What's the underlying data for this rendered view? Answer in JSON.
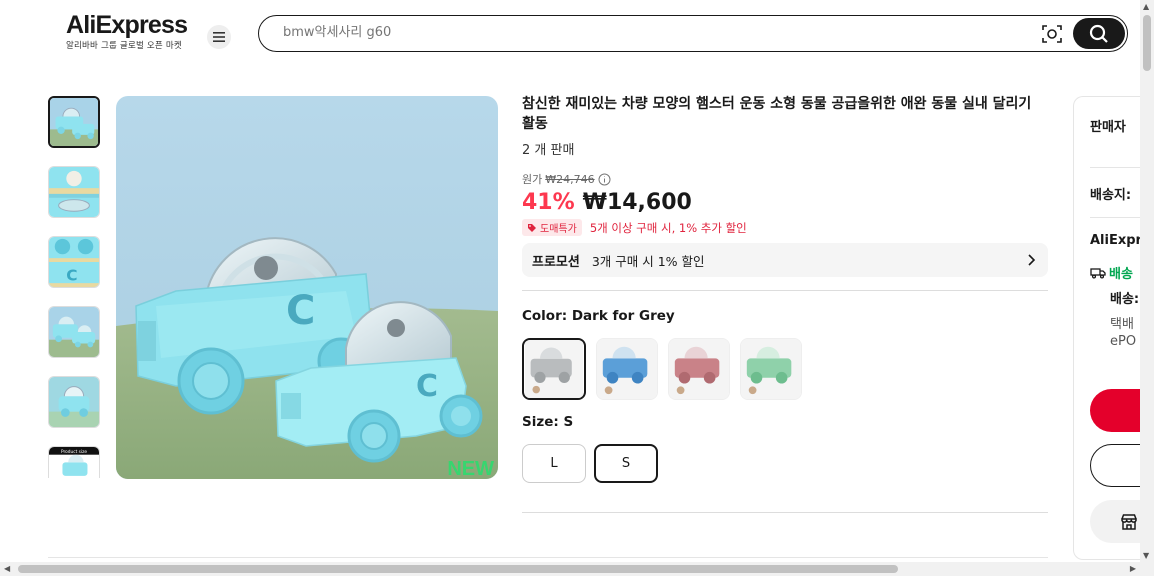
{
  "header": {
    "logo_text": "AliExpress",
    "logo_sub": "알리바바 그룹 글로벌 오픈 마켓",
    "search_placeholder": "bmw악세사리 g60"
  },
  "gallery": {
    "thumb_count": 6,
    "badge": "NEW",
    "thumb6_label": "Product size"
  },
  "product": {
    "title": "참신한 재미있는 차량 모양의 햄스터 운동 소형 동물 공급을위한 애완 동물 실내 달리기 활동",
    "sold": "2 개 판매",
    "original_label": "원가",
    "original_price": "₩24,746",
    "discount": "41%",
    "price": "₩14,600",
    "wholesale_badge": "도매특가",
    "wholesale_text": "5개 이상 구매 시, 1% 추가 할인",
    "promo_title": "프로모션",
    "promo_text": "3개 구매 시 1% 할인",
    "color_label": "Color: Dark for Grey",
    "swatches": [
      {
        "name": "grey",
        "color": "#b9bcbe"
      },
      {
        "name": "blue",
        "color": "#5b9fd8"
      },
      {
        "name": "red",
        "color": "#c98288"
      },
      {
        "name": "green",
        "color": "#8fd1aa"
      }
    ],
    "size_label": "Size: S",
    "sizes": [
      "L",
      "S"
    ],
    "selected_size": "S"
  },
  "side_panel": {
    "seller_label": "판매자",
    "ship_to_label": "배송지:",
    "ae_label": "AliExpre",
    "green_label": "배송",
    "delivery_label": "배송:",
    "line1": "택배",
    "line2": "ePO",
    "buy_color": "#e4002b"
  },
  "colors": {
    "accent_red": "#fd384f",
    "green": "#00a650"
  }
}
